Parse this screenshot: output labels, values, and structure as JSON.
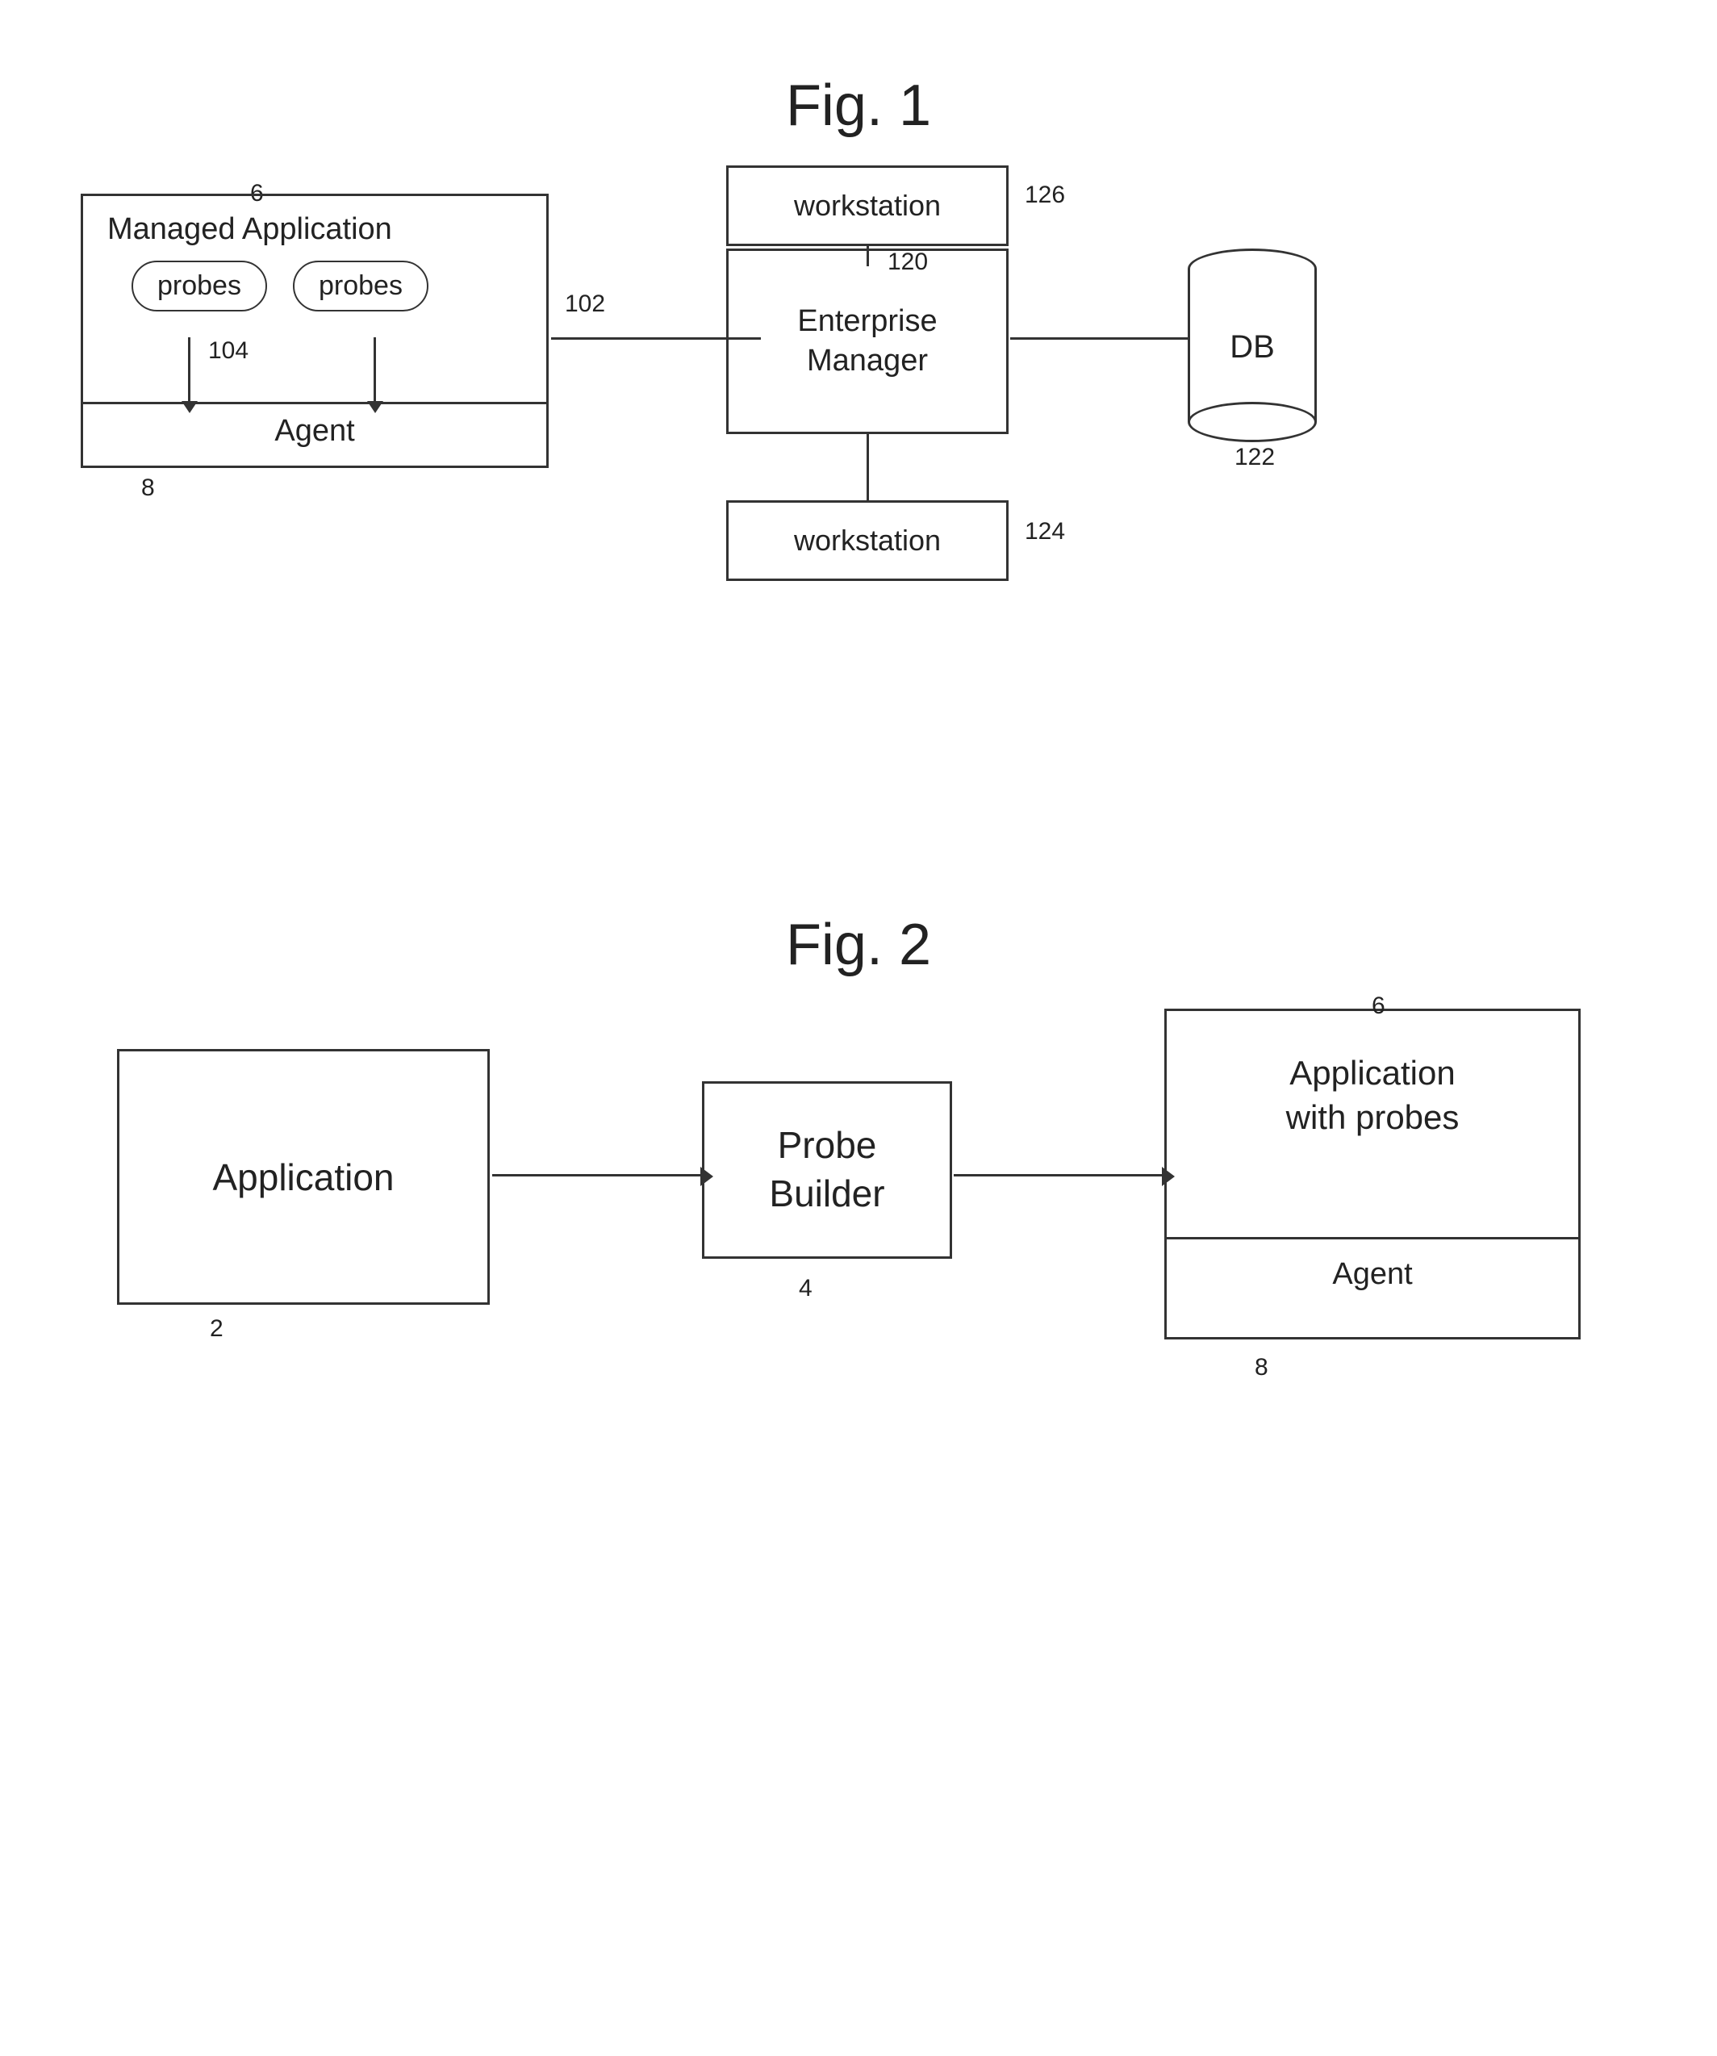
{
  "fig1": {
    "title": "Fig. 1",
    "managed_app": {
      "label": "Managed Application",
      "probe1": "probes",
      "probe2": "probes",
      "agent": "Agent",
      "ref_probe": "104",
      "ref_line": "102",
      "ref_box": "8",
      "ref_corner": "6"
    },
    "enterprise_manager": {
      "label": "Enterprise\nManager",
      "label_line1": "Enterprise",
      "label_line2": "Manager",
      "ref": "120"
    },
    "workstation_top": {
      "label": "workstation",
      "ref": "126"
    },
    "workstation_bottom": {
      "label": "workstation",
      "ref": "124"
    },
    "db": {
      "label": "DB",
      "ref": "122"
    }
  },
  "fig2": {
    "title": "Fig. 2",
    "application": {
      "label": "Application",
      "ref": "2"
    },
    "probe_builder": {
      "label_line1": "Probe",
      "label_line2": "Builder",
      "ref": "4"
    },
    "app_with_probes": {
      "label_line1": "Application",
      "label_line2": "with probes",
      "agent": "Agent",
      "ref_corner": "6",
      "ref_agent": "8"
    }
  }
}
